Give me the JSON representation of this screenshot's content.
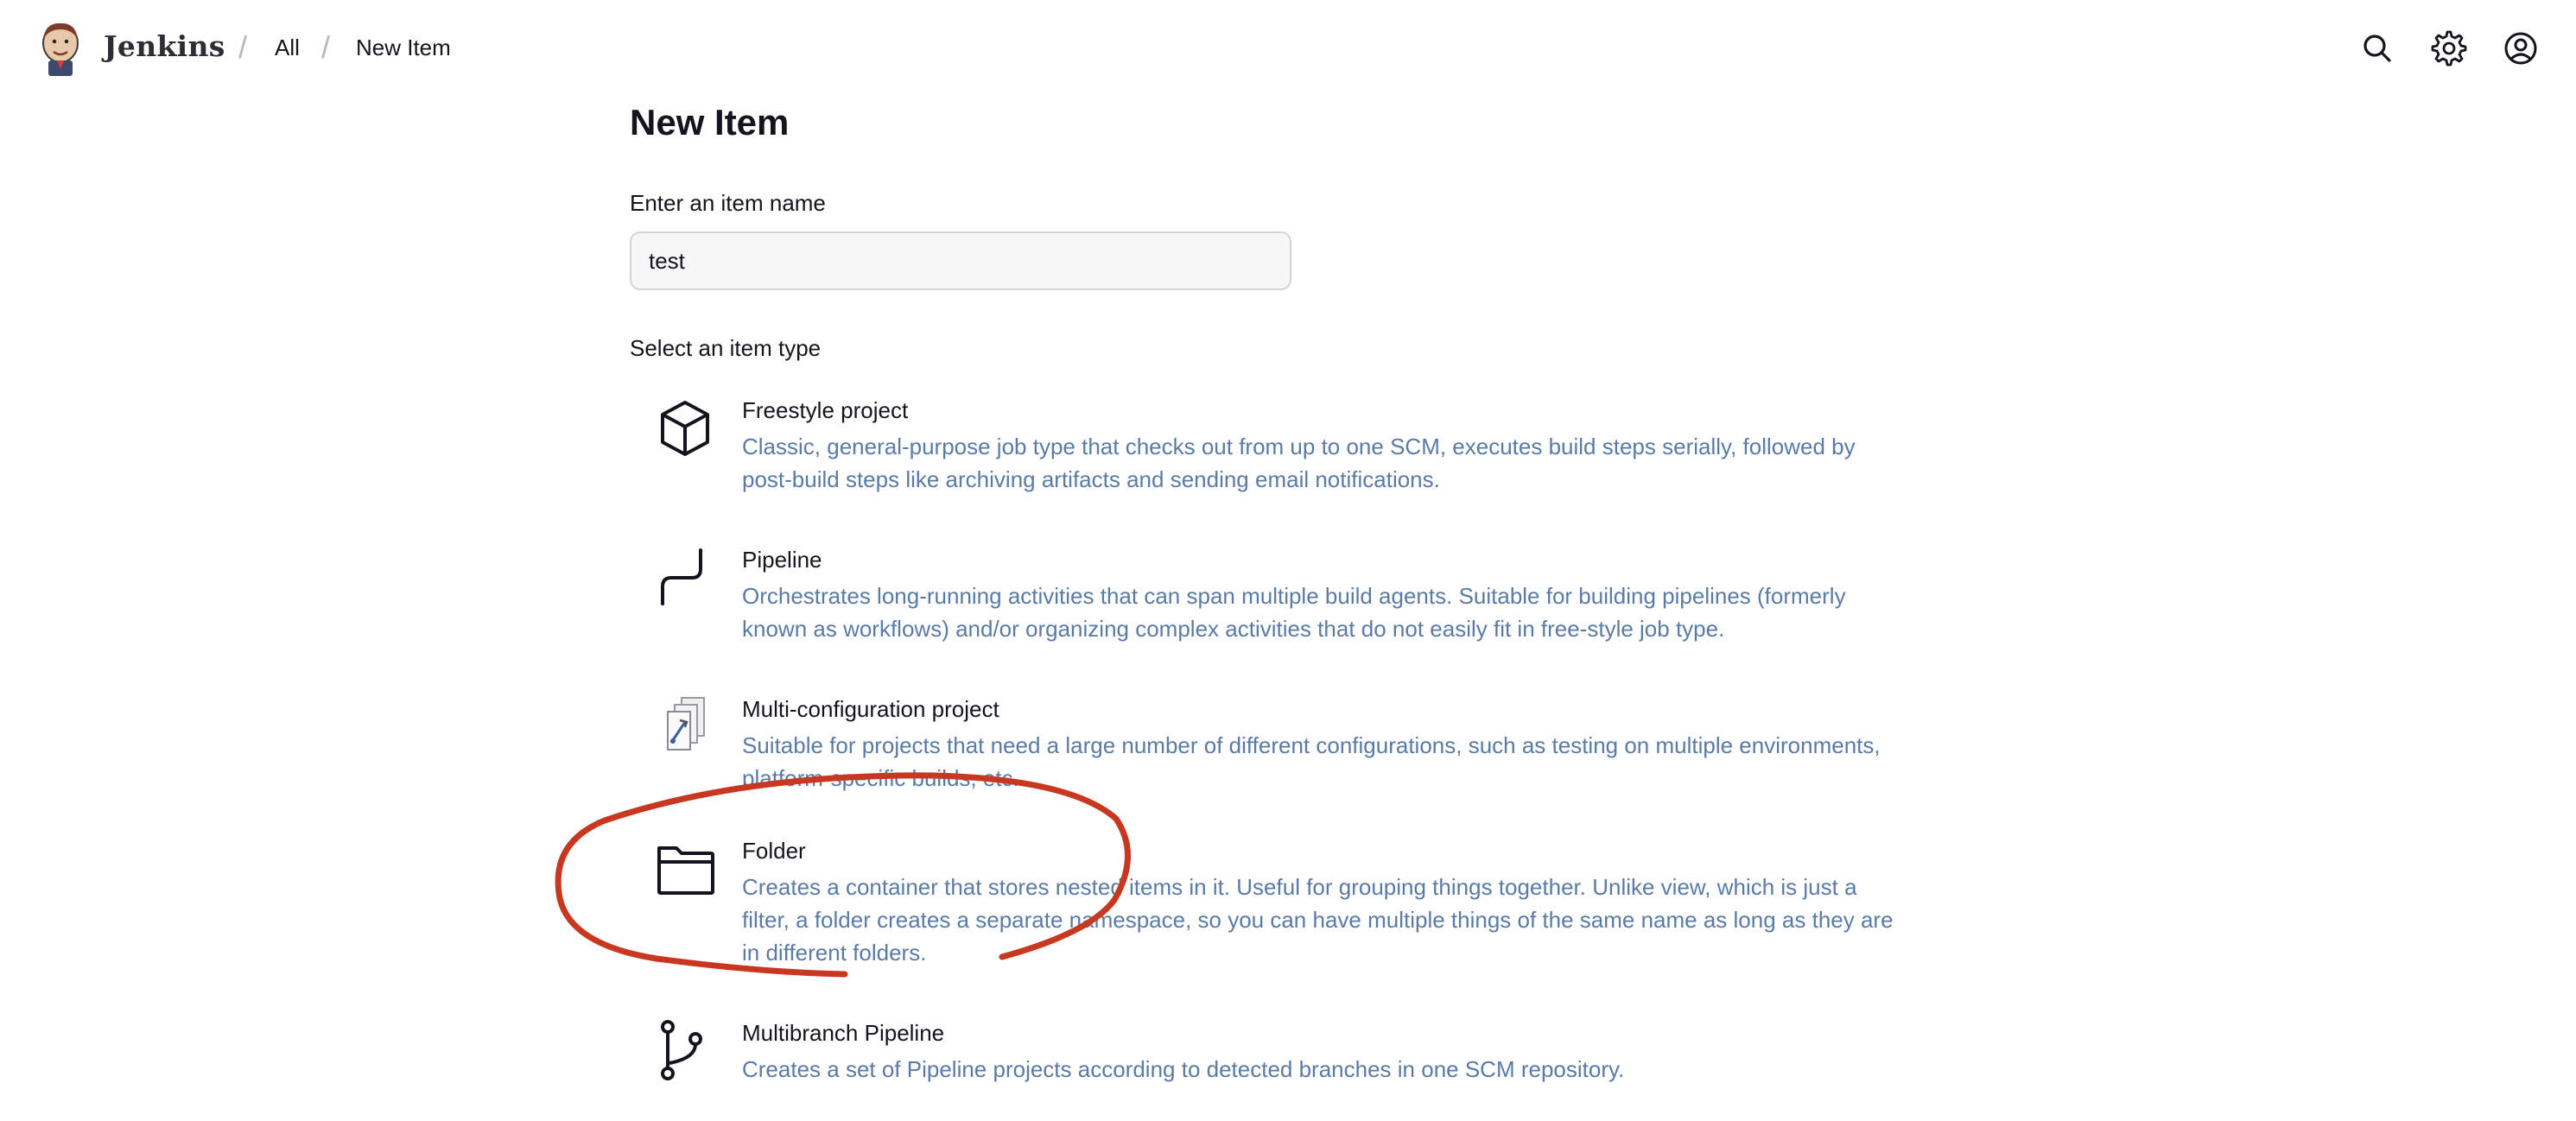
{
  "header": {
    "brand": "Jenkins",
    "breadcrumbs": [
      {
        "label": "All"
      },
      {
        "label": "New Item"
      }
    ],
    "icons": {
      "search": "search-icon",
      "settings": "gear-icon",
      "account": "user-circle-icon"
    }
  },
  "main": {
    "title": "New Item",
    "name_label": "Enter an item name",
    "name_value": "test",
    "type_label": "Select an item type",
    "item_types": [
      {
        "name": "Freestyle project",
        "icon": "box-icon",
        "description": "Classic, general-purpose job type that checks out from up to one SCM, executes build steps serially, followed by post-build steps like archiving artifacts and sending email notifications."
      },
      {
        "name": "Pipeline",
        "icon": "pipeline-icon",
        "description": "Orchestrates long-running activities that can span multiple build agents. Suitable for building pipelines (formerly known as workflows) and/or organizing complex activities that do not easily fit in free-style job type."
      },
      {
        "name": "Multi-configuration project",
        "icon": "multi-config-icon",
        "description": "Suitable for projects that need a large number of different configurations, such as testing on multiple environments, platform-specific builds, etc."
      },
      {
        "name": "Folder",
        "icon": "folder-icon",
        "description": "Creates a container that stores nested items in it. Useful for grouping things together. Unlike view, which is just a filter, a folder creates a separate namespace, so you can have multiple things of the same name as long as they are in different folders."
      },
      {
        "name": "Multibranch Pipeline",
        "icon": "branch-icon",
        "description": "Creates a set of Pipeline projects according to detected branches in one SCM repository."
      }
    ]
  },
  "colors": {
    "description_text": "#5a7ba6",
    "annotation_stroke": "#c8371f",
    "input_border": "#d4d4d8"
  }
}
